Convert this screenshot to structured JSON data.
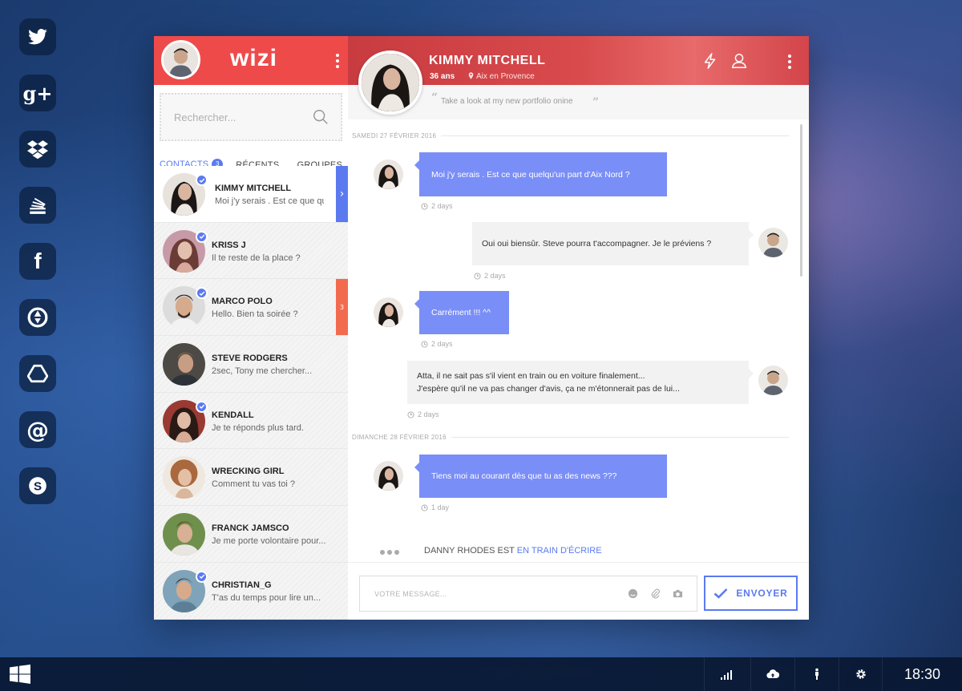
{
  "dock": [
    {
      "name": "twitter-icon"
    },
    {
      "name": "google-plus-icon",
      "glyph": "g+"
    },
    {
      "name": "dropbox-icon"
    },
    {
      "name": "stack-icon"
    },
    {
      "name": "facebook-icon",
      "glyph": "f"
    },
    {
      "name": "aperture-icon"
    },
    {
      "name": "drive-icon"
    },
    {
      "name": "at-mail-icon",
      "glyph": "@"
    },
    {
      "name": "skype-icon",
      "glyph": "S"
    }
  ],
  "app": {
    "logo": "wizi",
    "search": {
      "placeholder": "Rechercher..."
    },
    "tabs": [
      {
        "label": "CONTACTS",
        "badge": "3",
        "active": true
      },
      {
        "label": "RÉCENTS"
      },
      {
        "label": "GROUPES"
      }
    ],
    "contacts": [
      {
        "name": "KIMMY MITCHELL",
        "message": "Moi j'y serais . Est ce que quelqu'un part d'Aix Nord ?",
        "online": true,
        "active": true,
        "strip": "›"
      },
      {
        "name": "KRISS J",
        "message": "Il te reste de la place ?",
        "online": true
      },
      {
        "name": "MARCO POLO",
        "message": "Hello. Bien ta soirée ?",
        "online": true,
        "strip": "3"
      },
      {
        "name": "STEVE RODGERS",
        "message": "2sec, Tony me chercher...",
        "online": false
      },
      {
        "name": "KENDALL",
        "message": "Je te réponds plus tard.",
        "online": true
      },
      {
        "name": "WRECKING GIRL",
        "message": "Comment tu vas toi ?",
        "online": false
      },
      {
        "name": "FRANCK JAMSCO",
        "message": "Je me porte volontaire pour...",
        "online": false
      },
      {
        "name": "CHRISTIAN_G",
        "message": "T'as du temps pour lire un...",
        "online": true
      }
    ],
    "peer": {
      "name": "KIMMY MITCHELL",
      "age": "36 ans",
      "location": "Aix en Provence",
      "status": "Take a look at my new portfolio onine"
    },
    "days": [
      {
        "label": "SAMEDI 27 FÉVRIER 2016"
      },
      {
        "label": "DIMANCHE 28 FÉVRIER 2016"
      }
    ],
    "messages": [
      {
        "dir": "in",
        "text": "Moi j'y serais . Est ce que quelqu'un part d'Aix Nord ?",
        "time": "2 days"
      },
      {
        "dir": "out",
        "text": "Oui oui biensûr. Steve pourra t'accompagner. Je le préviens ?",
        "time": "2 days"
      },
      {
        "dir": "in",
        "text": "Carrément !!! ^^",
        "time": "2 days"
      },
      {
        "dir": "out",
        "line1": "Atta, il ne sait pas s'il vient en train ou en voiture finalement...",
        "line2": "J'espère qu'il ne va pas changer d'avis, ça ne m'étonnerait pas de lui...",
        "time": "2 days"
      },
      {
        "dir": "in",
        "text": "Tiens moi au courant dès que tu as des news ???",
        "time": "1 day"
      }
    ],
    "typing": {
      "who": "DANNY RHODES EST",
      "status": "EN TRAIN D'ÉCRIRE"
    },
    "composer": {
      "placeholder": "VOTRE MESSAGE...",
      "send_label": "ENVOYER"
    }
  },
  "taskbar": {
    "clock": "18:30"
  },
  "colors": {
    "brand_red": "#ef4a4a",
    "accent_blue": "#5b7af0",
    "bubble_blue": "#7a8ef7",
    "unread_orange": "#f26b4f"
  }
}
